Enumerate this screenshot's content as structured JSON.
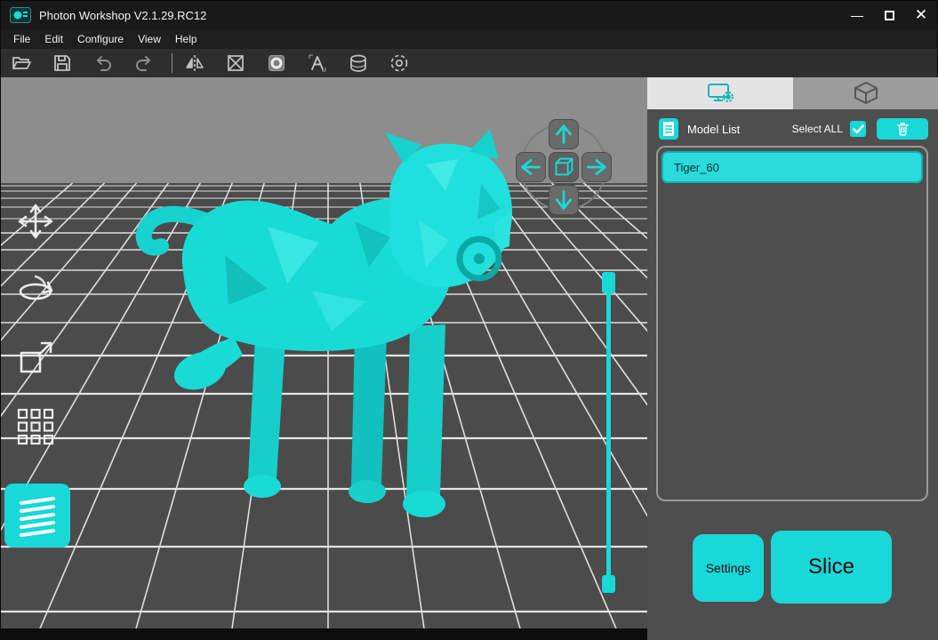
{
  "titlebar": {
    "title": "Photon Workshop V2.1.29.RC12",
    "minimize_glyph": "—",
    "close_glyph": "✕"
  },
  "menu": {
    "items": [
      "File",
      "Edit",
      "Configure",
      "View",
      "Help"
    ]
  },
  "toolbar": {
    "icon_names": [
      "open-icon",
      "save-icon",
      "undo-icon",
      "redo-icon",
      "mirror-icon",
      "split-icon",
      "hollow-icon",
      "text-icon",
      "cylinder-icon",
      "support-icon"
    ]
  },
  "viewport": {
    "left_tool_icon_names": [
      "move-tool-icon",
      "rotate-tool-icon",
      "scale-tool-icon",
      "array-tool-icon",
      "layers-tool-icon"
    ],
    "nav_icon_names": [
      "nav-up-arrow-icon",
      "nav-down-arrow-icon",
      "nav-left-arrow-icon",
      "nav-right-arrow-icon",
      "nav-home-cube-icon"
    ]
  },
  "right_panel": {
    "tabs": [
      {
        "name": "slice-settings-tab",
        "icon": "monitor-gear-icon",
        "active": true
      },
      {
        "name": "preview-tab",
        "icon": "cube-wireframe-icon",
        "active": false
      }
    ],
    "model_list": {
      "label": "Model List",
      "select_all_label": "Select ALL",
      "select_all_checked": true,
      "items": [
        {
          "name": "Tiger_60"
        }
      ]
    },
    "settings_button_label": "Settings",
    "slice_button_label": "Slice"
  },
  "colors": {
    "accent": "#19d8d8",
    "panel": "#4e4e4e",
    "sky": "#8d8d8d",
    "ground": "#4b4b4b",
    "grid_line": "#dedede"
  }
}
